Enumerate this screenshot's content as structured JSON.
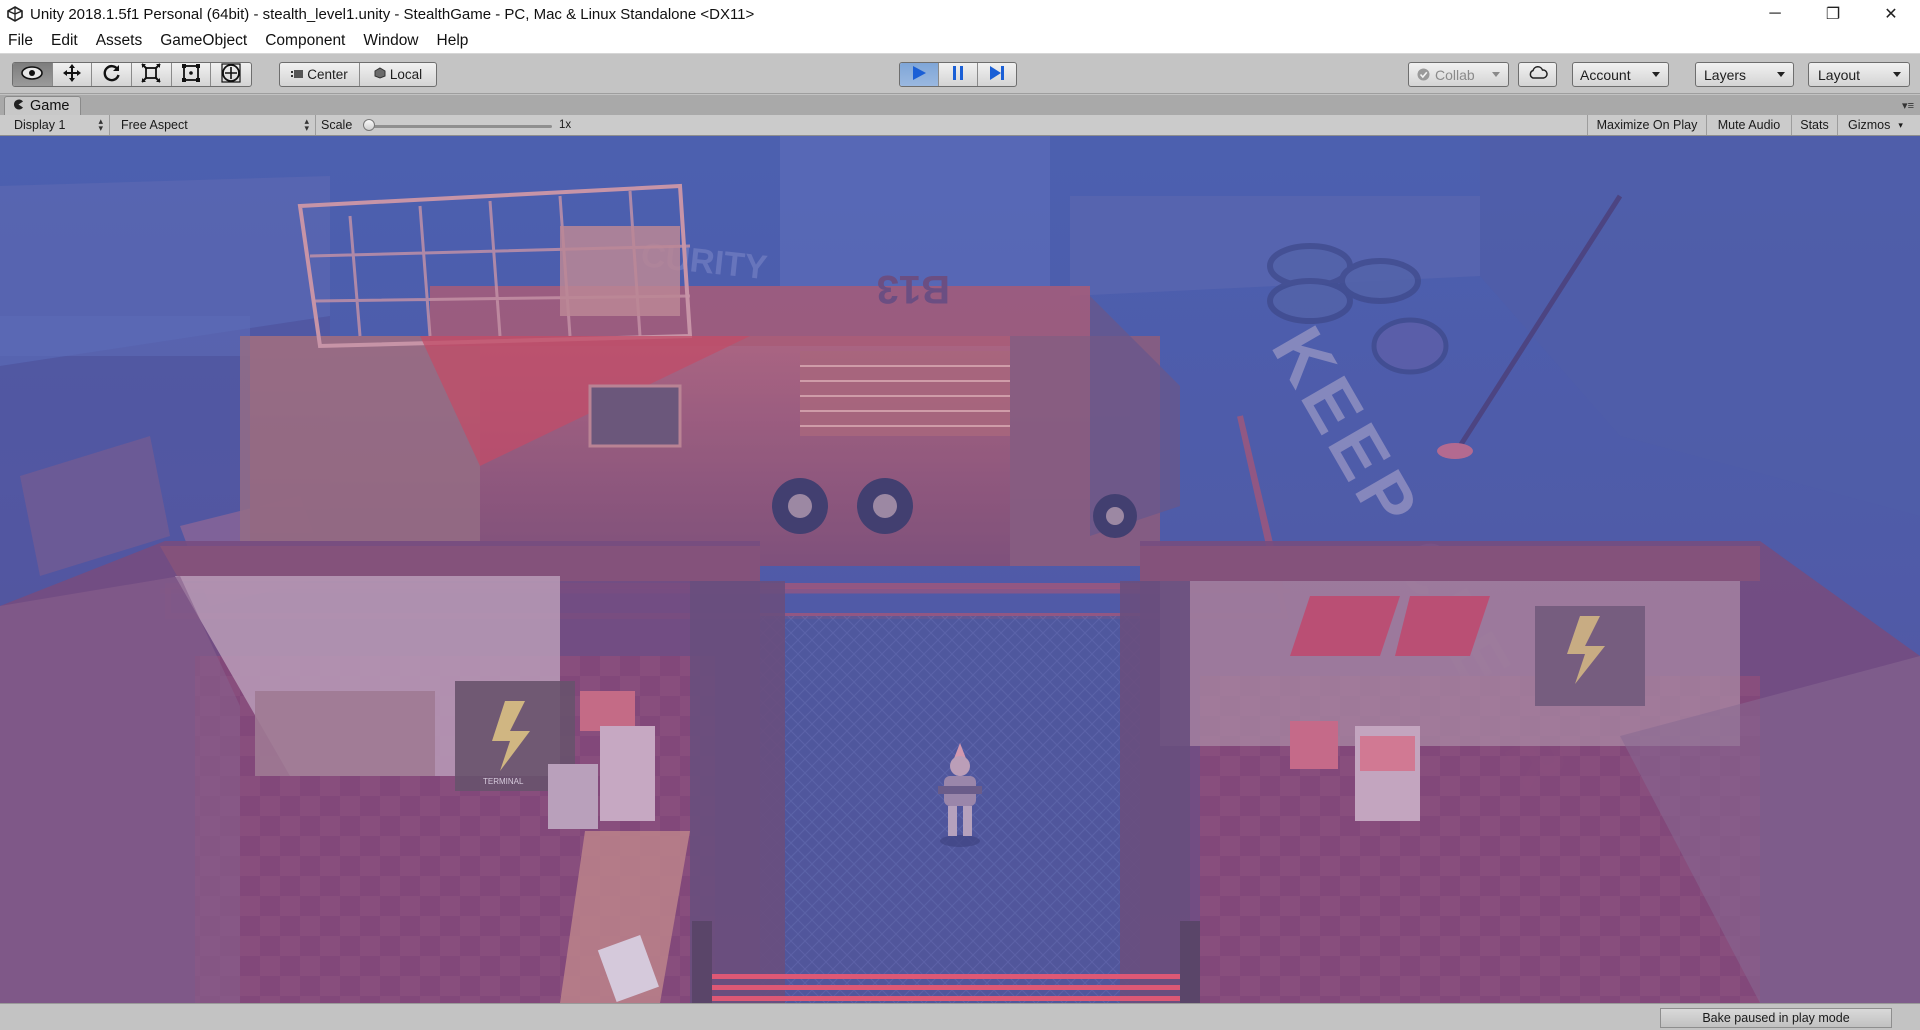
{
  "window": {
    "title": "Unity 2018.1.5f1 Personal (64bit) - stealth_level1.unity - StealthGame - PC, Mac & Linux Standalone <DX11>",
    "controls": {
      "minimize": "─",
      "maximize": "❐",
      "close": "✕"
    }
  },
  "menu": {
    "items": [
      "File",
      "Edit",
      "Assets",
      "GameObject",
      "Component",
      "Window",
      "Help"
    ]
  },
  "toolbar": {
    "transform_tools": [
      "hand-tool-icon",
      "move-tool-icon",
      "rotate-tool-icon",
      "scale-tool-icon",
      "rect-tool-icon",
      "transform-tool-icon"
    ],
    "active_tool": "hand-tool-icon",
    "pivot_label": "Center",
    "space_label": "Local",
    "play_state": "playing",
    "collab_label": "Collab",
    "account_label": "Account",
    "layers_label": "Layers",
    "layout_label": "Layout"
  },
  "game_tab": {
    "label": "Game"
  },
  "game_view": {
    "display_label": "Display 1",
    "aspect_label": "Free Aspect",
    "scale_label": "Scale",
    "scale_value": "1x",
    "maximize_label": "Maximize On Play",
    "mute_label": "Mute Audio",
    "stats_label": "Stats",
    "gizmos_label": "Gizmos"
  },
  "scene": {
    "truck_plate": "B13",
    "wall_sign": "CURITY",
    "floor_text": "KEEP CLEAR",
    "terminal_label": "TERMINAL",
    "palette": {
      "fog": "#4c5a9d",
      "accent_red": "#e04a62",
      "floor_pink": "#8a4a72"
    }
  },
  "status": {
    "bake_label": "Bake paused in play mode"
  },
  "colors": {
    "toolbar_bg": "#c4c4c4",
    "play_active": "#8fb0dd",
    "title_bg": "#ffffff"
  }
}
